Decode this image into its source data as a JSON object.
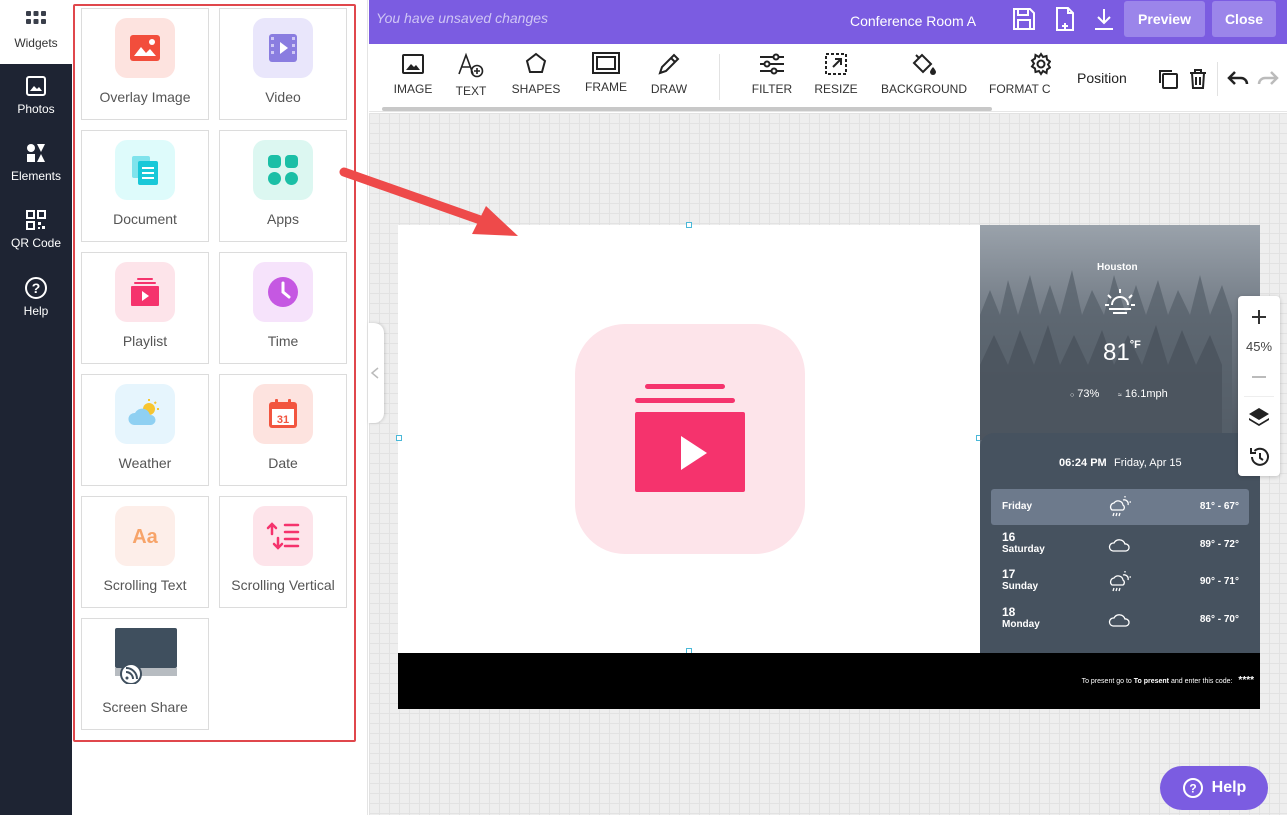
{
  "nav": {
    "items": [
      {
        "label": "Widgets",
        "icon": "grid-icon"
      },
      {
        "label": "Photos",
        "icon": "photo-icon"
      },
      {
        "label": "Elements",
        "icon": "elements-icon"
      },
      {
        "label": "QR Code",
        "icon": "qr-code-icon"
      },
      {
        "label": "Help",
        "icon": "help-icon"
      }
    ]
  },
  "widgets": [
    {
      "label": "Overlay Image",
      "icon": "image-icon",
      "bg": "#fde3df"
    },
    {
      "label": "Video",
      "icon": "video-icon",
      "bg": "#e9e6fb"
    },
    {
      "label": "Document",
      "icon": "document-icon",
      "bg": "#defbfb"
    },
    {
      "label": "Apps",
      "icon": "apps-icon",
      "bg": "#dcf7f1"
    },
    {
      "label": "Playlist",
      "icon": "playlist-icon",
      "bg": "#fde4ea"
    },
    {
      "label": "Time",
      "icon": "clock-icon",
      "bg": "#f6e3fb"
    },
    {
      "label": "Weather",
      "icon": "weather-icon",
      "bg": "#e6f5fd"
    },
    {
      "label": "Date",
      "icon": "calendar-icon",
      "bg": "#fde3df"
    },
    {
      "label": "Scrolling Text",
      "icon": "text-icon",
      "bg": "#fdeee9"
    },
    {
      "label": "Scrolling Vertical",
      "icon": "scroll-vertical-icon",
      "bg": "#fde4ea"
    },
    {
      "label": "Screen Share",
      "icon": "screen-share-icon",
      "bg": "#ffffff"
    }
  ],
  "topbar": {
    "unsaved": "You have unsaved changes",
    "room": "Conference Room A",
    "preview": "Preview",
    "close": "Close"
  },
  "toolbar": {
    "tools": [
      "IMAGE",
      "TEXT",
      "SHAPES",
      "FRAME",
      "DRAW",
      "FILTER",
      "RESIZE",
      "BACKGROUND",
      "FORMAT C"
    ],
    "position": "Position"
  },
  "weather": {
    "city": "Houston",
    "temp": "81",
    "unit": "°F",
    "humidity": "73%",
    "wind": "16.1mph",
    "time": "06:24 PM",
    "date": "Friday, Apr 15",
    "forecast": [
      {
        "num": "",
        "day": "Friday",
        "temp": "81° - 67°"
      },
      {
        "num": "16",
        "day": "Saturday",
        "temp": "89° - 72°"
      },
      {
        "num": "17",
        "day": "Sunday",
        "temp": "90° - 71°"
      },
      {
        "num": "18",
        "day": "Monday",
        "temp": "86° - 70°"
      }
    ]
  },
  "footer": {
    "present_prefix": "To present go to",
    "present_bold": "To present",
    "present_suffix": "and enter this code:",
    "code": "****"
  },
  "zoom": {
    "level": "45%"
  },
  "help": {
    "label": "Help"
  },
  "colors": {
    "accent": "#7b5ce1",
    "playlist": "#f5336d",
    "outline": "#e0474c"
  }
}
